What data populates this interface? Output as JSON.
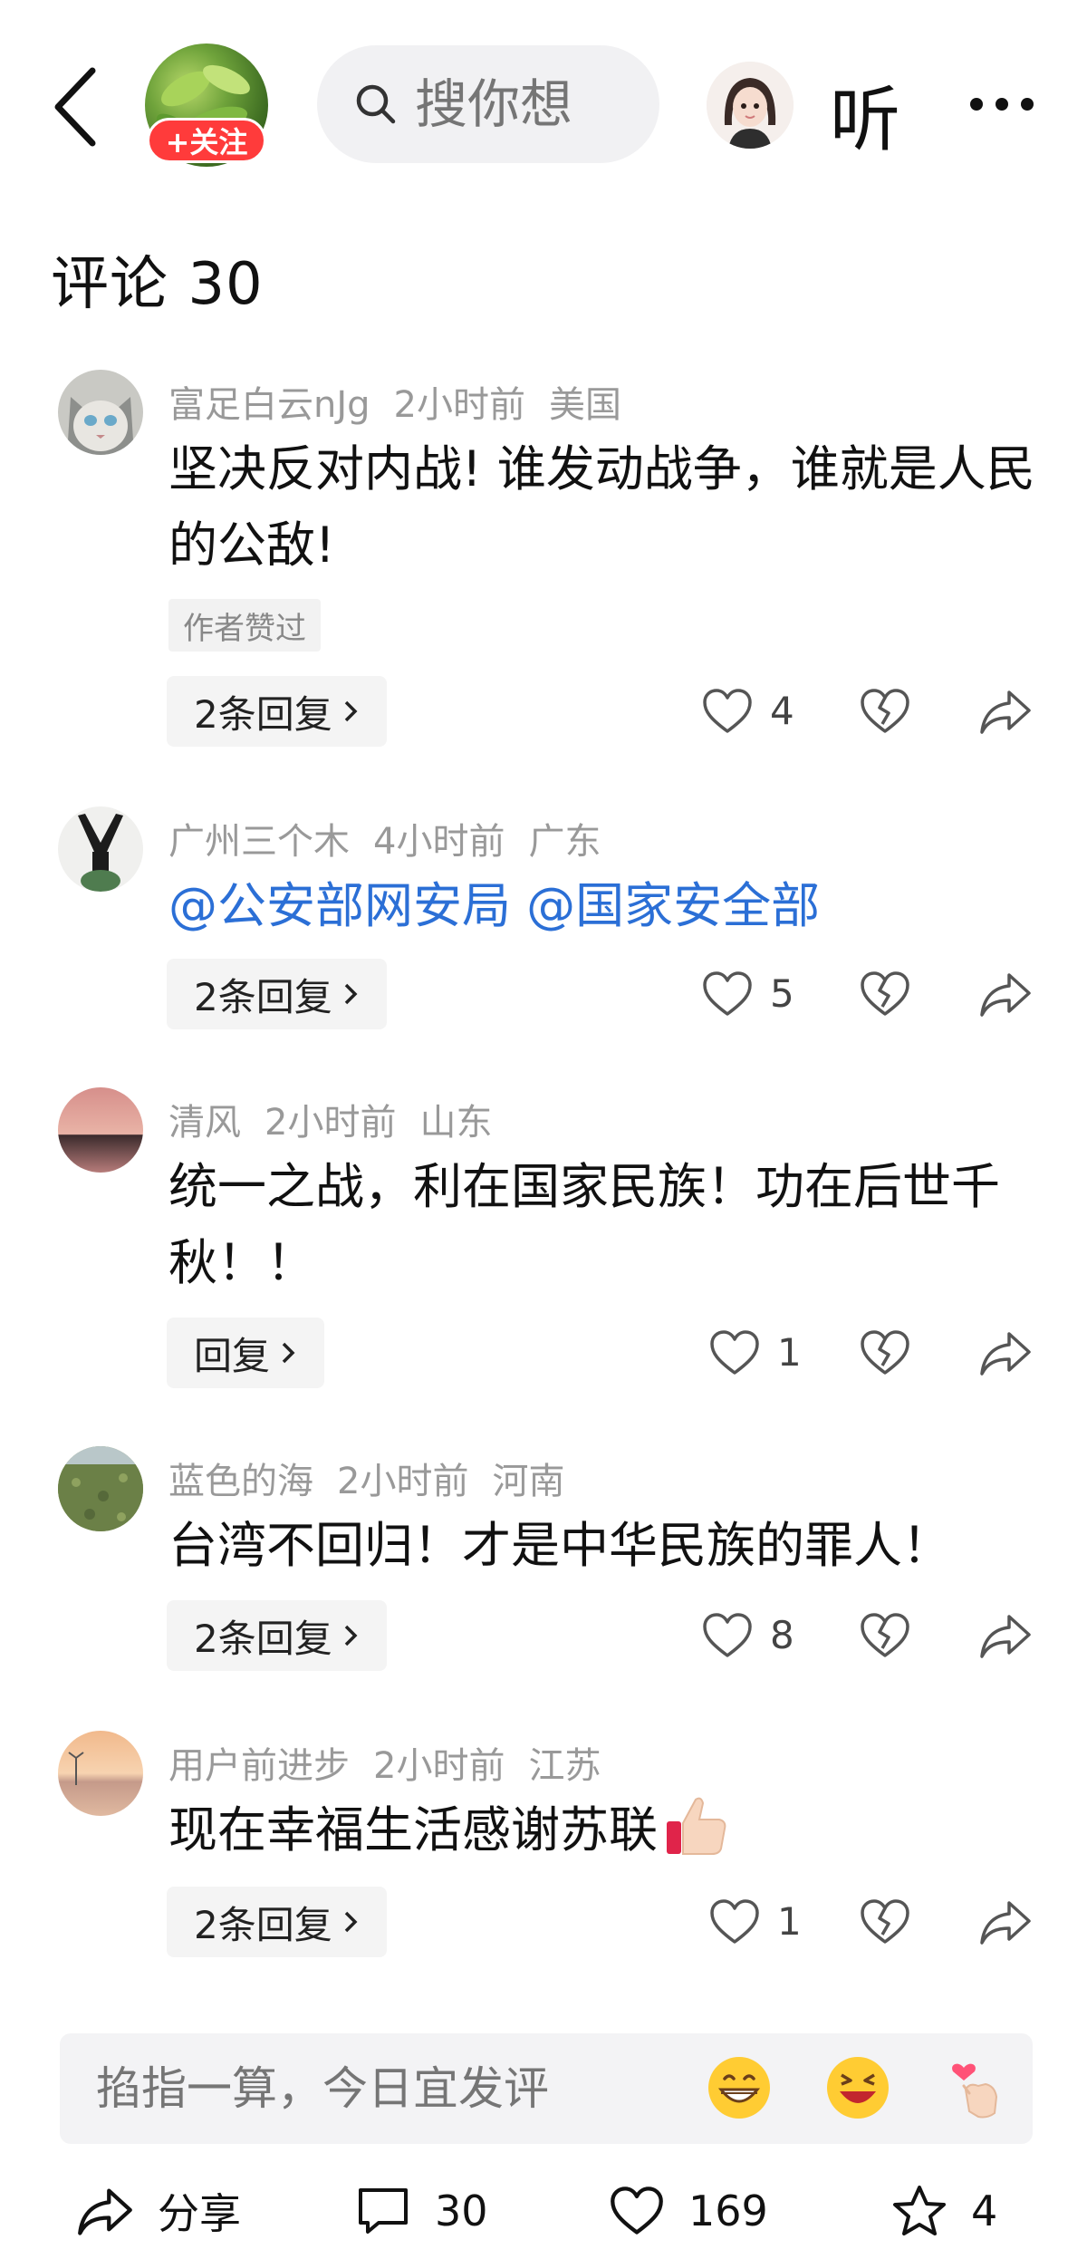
{
  "header": {
    "follow_label": "+关注",
    "search_placeholder": "搜你想",
    "listen_label": "听"
  },
  "comments_section": {
    "title": "评论 30"
  },
  "comments": [
    {
      "username": "富足白云nJg",
      "time": "2小时前",
      "location": "美国",
      "text": "坚决反对内战! 谁发动战争，谁就是人民的公敌!",
      "author_liked": "作者赞过",
      "reply_label": "2条回复",
      "likes": "4"
    },
    {
      "username": "广州三个木",
      "time": "4小时前",
      "location": "广东",
      "text": "@公安部网安局 @国家安全部",
      "reply_label": "2条回复",
      "likes": "5"
    },
    {
      "username": "清风",
      "time": "2小时前",
      "location": "山东",
      "text": "统一之战，利在国家民族！功在后世千秋！！",
      "reply_label": "回复",
      "likes": "1"
    },
    {
      "username": "蓝色的海",
      "time": "2小时前",
      "location": "河南",
      "text": "台湾不回归！才是中华民族的罪人！",
      "reply_label": "2条回复",
      "likes": "8"
    },
    {
      "username": "用户前进步",
      "time": "2小时前",
      "location": "江苏",
      "text": "现在幸福生活感谢苏联",
      "reply_label": "2条回复",
      "likes": "1"
    }
  ],
  "comment_input": {
    "placeholder": "掐指一算，今日宜发评"
  },
  "bottom_bar": {
    "share_label": "分享",
    "comment_count": "30",
    "like_count": "169",
    "favorite_count": "4"
  },
  "colors": {
    "follow_red": "#ff3b3b",
    "mention_blue": "#2b6fd6",
    "meta_gray": "#999999"
  }
}
